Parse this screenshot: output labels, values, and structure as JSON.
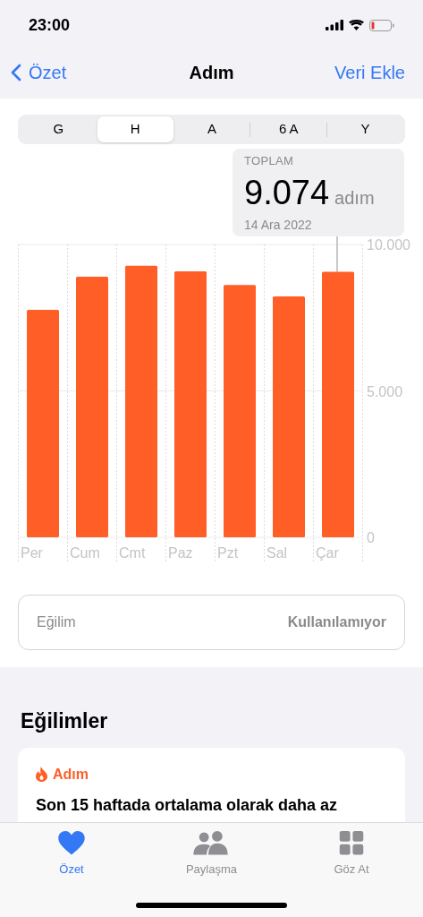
{
  "status_bar": {
    "time": "23:00"
  },
  "nav": {
    "back": "Özet",
    "title": "Adım",
    "action": "Veri Ekle"
  },
  "segments": [
    {
      "label": "G",
      "selected": false
    },
    {
      "label": "H",
      "selected": true
    },
    {
      "label": "A",
      "selected": false
    },
    {
      "label": "6 A",
      "selected": false
    },
    {
      "label": "Y",
      "selected": false
    }
  ],
  "tooltip": {
    "label": "TOPLAM",
    "value": "9.074",
    "unit": "adım",
    "date": "14 Ara 2022"
  },
  "chart_data": {
    "type": "bar",
    "categories": [
      "Per",
      "Cum",
      "Cmt",
      "Paz",
      "Pzt",
      "Sal",
      "Çar"
    ],
    "series": [
      {
        "color": "#ff5e27",
        "values": [
          7770,
          8900,
          9270,
          9080,
          8620,
          8230,
          9070
        ]
      }
    ],
    "ylim": [
      0,
      10000
    ],
    "yticks": [
      0,
      {
        "value": 5000,
        "label": "5.000"
      },
      {
        "value": 10000,
        "label": "10.000"
      }
    ]
  },
  "trend_row": {
    "label": "Eğilim",
    "value": "Kullanılamıyor"
  },
  "section_title": "Eğilimler",
  "trend_card": {
    "category": "Adım",
    "text": "Son 15 haftada ortalama olarak daha az"
  },
  "tab_bar": [
    {
      "kind": "heart",
      "label": "Özet",
      "selected": true
    },
    {
      "kind": "people",
      "label": "Paylaşma",
      "selected": false
    },
    {
      "kind": "grid",
      "label": "Göz At",
      "selected": false
    }
  ]
}
